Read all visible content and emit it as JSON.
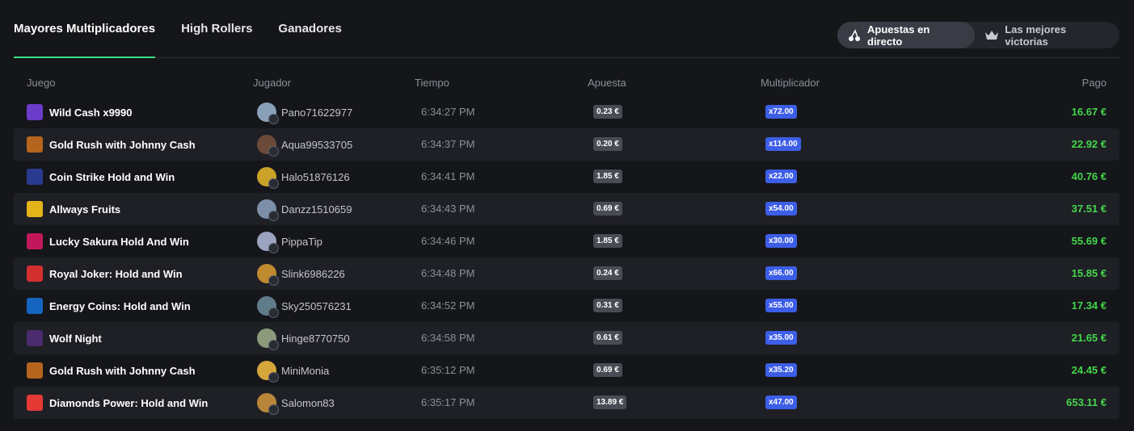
{
  "tabs": [
    {
      "label": "Mayores Multiplicadores",
      "active": true
    },
    {
      "label": "High Rollers",
      "active": false
    },
    {
      "label": "Ganadores",
      "active": false
    }
  ],
  "toggle": {
    "live": {
      "label": "Apuestas en directo",
      "icon": "cherry-icon",
      "active": true
    },
    "best": {
      "label": "Las mejores victorias",
      "icon": "crown-icon",
      "active": false
    }
  },
  "columns": {
    "game": "Juego",
    "player": "Jugador",
    "time": "Tiempo",
    "bet": "Apuesta",
    "multiplier": "Multiplicador",
    "payout": "Pago"
  },
  "colors": {
    "accent_green": "#3ddc84",
    "payout_green": "#44d64b",
    "multiplier_blue": "#3d5ee6"
  },
  "rows": [
    {
      "game": "Wild Cash x9990",
      "player": "Pano71622977",
      "time": "6:34:27 PM",
      "bet": "0.23 €",
      "multiplier": "x72.00",
      "payout": "16.67 €"
    },
    {
      "game": "Gold Rush with Johnny Cash",
      "player": "Aqua99533705",
      "time": "6:34:37 PM",
      "bet": "0.20 €",
      "multiplier": "x114.00",
      "payout": "22.92 €"
    },
    {
      "game": "Coin Strike Hold and Win",
      "player": "Halo51876126",
      "time": "6:34:41 PM",
      "bet": "1.85 €",
      "multiplier": "x22.00",
      "payout": "40.76 €"
    },
    {
      "game": "Allways Fruits",
      "player": "Danzz1510659",
      "time": "6:34:43 PM",
      "bet": "0.69 €",
      "multiplier": "x54.00",
      "payout": "37.51 €"
    },
    {
      "game": "Lucky Sakura Hold And Win",
      "player": "PippaTip",
      "time": "6:34:46 PM",
      "bet": "1.85 €",
      "multiplier": "x30.00",
      "payout": "55.69 €"
    },
    {
      "game": "Royal Joker: Hold and Win",
      "player": "Slink6986226",
      "time": "6:34:48 PM",
      "bet": "0.24 €",
      "multiplier": "x66.00",
      "payout": "15.85 €"
    },
    {
      "game": "Energy Coins: Hold and Win",
      "player": "Sky250576231",
      "time": "6:34:52 PM",
      "bet": "0.31 €",
      "multiplier": "x55.00",
      "payout": "17.34 €"
    },
    {
      "game": "Wolf Night",
      "player": "Hinge8770750",
      "time": "6:34:58 PM",
      "bet": "0.61 €",
      "multiplier": "x35.00",
      "payout": "21.65 €"
    },
    {
      "game": "Gold Rush with Johnny Cash",
      "player": "MiniMonia",
      "time": "6:35:12 PM",
      "bet": "0.69 €",
      "multiplier": "x35.20",
      "payout": "24.45 €"
    },
    {
      "game": "Diamonds Power: Hold and Win",
      "player": "Salomon83",
      "time": "6:35:17 PM",
      "bet": "13.89 €",
      "multiplier": "x47.00",
      "payout": "653.11 €"
    }
  ]
}
